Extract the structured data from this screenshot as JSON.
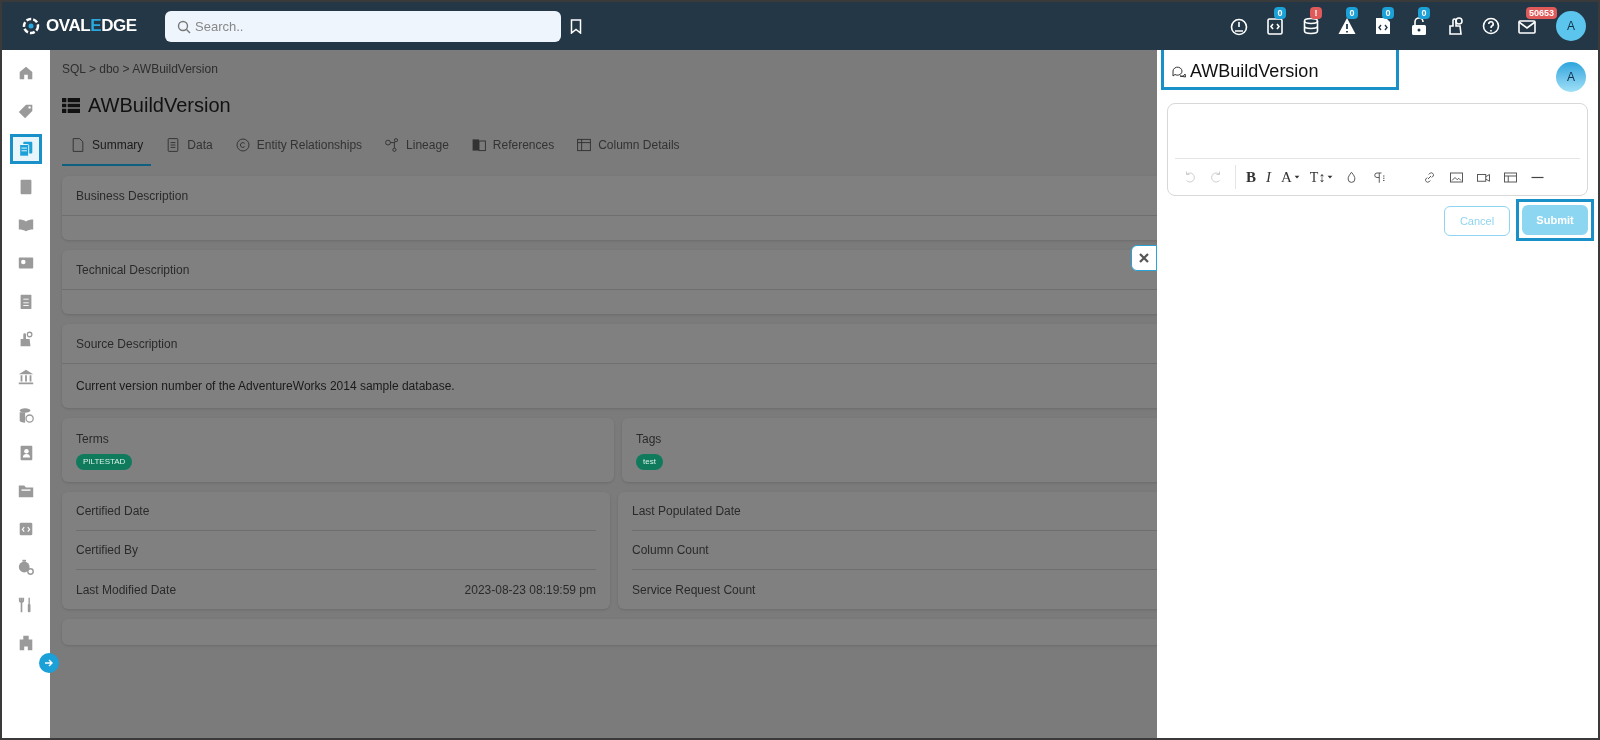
{
  "header": {
    "logo": {
      "before": "OVAL",
      "accent": "E",
      "after": "DGE"
    },
    "search": {
      "placeholder": "Search.."
    },
    "icons": [
      {
        "kind": "gauge"
      },
      {
        "kind": "code-doc",
        "badge": "0",
        "color": "#1ba0d8"
      },
      {
        "kind": "database",
        "badge": "!",
        "color": "#e05a5a"
      },
      {
        "kind": "warning",
        "badge": "0",
        "color": "#1ba0d8"
      },
      {
        "kind": "code-file",
        "badge": "0",
        "color": "#1ba0d8"
      },
      {
        "kind": "lock",
        "badge": "0",
        "color": "#1ba0d8"
      },
      {
        "kind": "hand"
      },
      {
        "kind": "help"
      },
      {
        "kind": "mail",
        "badge": "50653",
        "color": "#e05a5a"
      }
    ],
    "avatar": "A"
  },
  "sidebar": {
    "items": [
      {
        "kind": "home",
        "selected": false
      },
      {
        "kind": "tag",
        "selected": false
      },
      {
        "kind": "copy",
        "selected": true
      },
      {
        "kind": "book",
        "selected": false
      },
      {
        "kind": "open-book",
        "selected": false
      },
      {
        "kind": "chart",
        "selected": false
      },
      {
        "kind": "clipboard",
        "selected": false
      },
      {
        "kind": "hand",
        "selected": false
      },
      {
        "kind": "bank",
        "selected": false
      },
      {
        "kind": "database",
        "selected": false
      },
      {
        "kind": "contact",
        "selected": false
      },
      {
        "kind": "folder",
        "selected": false
      },
      {
        "kind": "code",
        "selected": false
      },
      {
        "kind": "timer",
        "selected": false
      },
      {
        "kind": "tools",
        "selected": false
      },
      {
        "kind": "building",
        "selected": false
      }
    ]
  },
  "breadcrumb": "SQL > dbo > AWBuildVersion",
  "title": "AWBuildVersion",
  "tabs": [
    {
      "label": "Summary",
      "kind": "doc",
      "selected": true
    },
    {
      "label": "Data",
      "kind": "lines",
      "selected": false
    },
    {
      "label": "Entity Relationships",
      "kind": "circle",
      "selected": false
    },
    {
      "label": "Lineage",
      "kind": "branch",
      "selected": false
    },
    {
      "label": "References",
      "kind": "refs",
      "selected": false
    },
    {
      "label": "Column Details",
      "kind": "table",
      "selected": false
    }
  ],
  "sections": [
    {
      "label": "Business Description"
    },
    {
      "label": "Technical Description"
    },
    {
      "label": "Source Description",
      "text": "Current version number of the AdventureWorks 2014 sample database."
    }
  ],
  "terms": {
    "label": "Terms",
    "chips": [
      "PILTESTAD"
    ]
  },
  "tags": {
    "label": "Tags",
    "chips": [
      "test"
    ]
  },
  "details_left": [
    {
      "label": "Certified Date"
    },
    {
      "label": "Certified By"
    },
    {
      "label": "Last Modified Date",
      "value": "2023-08-23 08:19:59 pm"
    }
  ],
  "details_right": [
    {
      "label": "Last Populated Date"
    },
    {
      "label": "Column Count"
    },
    {
      "label": "Service Request Count"
    }
  ],
  "panel": {
    "title": "AWBuildVersion",
    "avatar": "A",
    "toolbar": [
      {
        "kind": "undo",
        "disabled": true
      },
      {
        "kind": "redo",
        "disabled": true
      },
      {
        "kind": "bold",
        "glyph": "B"
      },
      {
        "kind": "italic",
        "glyph": "I"
      },
      {
        "kind": "font-color",
        "glyph": "A"
      },
      {
        "kind": "font-size",
        "glyph": "T↕"
      },
      {
        "kind": "ink"
      },
      {
        "kind": "paragraph"
      },
      {
        "kind": "link"
      },
      {
        "kind": "image"
      },
      {
        "kind": "video"
      },
      {
        "kind": "table"
      },
      {
        "kind": "rule"
      }
    ],
    "buttons": [
      {
        "label": "Cancel",
        "kind": "outline"
      },
      {
        "label": "Submit",
        "kind": "primary"
      }
    ]
  }
}
